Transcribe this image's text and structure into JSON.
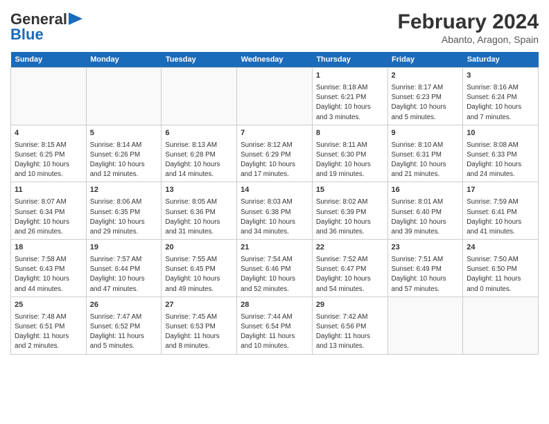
{
  "header": {
    "logo_line1": "General",
    "logo_line2": "Blue",
    "title": "February 2024",
    "subtitle": "Abanto, Aragon, Spain"
  },
  "weekdays": [
    "Sunday",
    "Monday",
    "Tuesday",
    "Wednesday",
    "Thursday",
    "Friday",
    "Saturday"
  ],
  "weeks": [
    [
      {
        "day": "",
        "info": ""
      },
      {
        "day": "",
        "info": ""
      },
      {
        "day": "",
        "info": ""
      },
      {
        "day": "",
        "info": ""
      },
      {
        "day": "1",
        "info": "Sunrise: 8:18 AM\nSunset: 6:21 PM\nDaylight: 10 hours\nand 3 minutes."
      },
      {
        "day": "2",
        "info": "Sunrise: 8:17 AM\nSunset: 6:23 PM\nDaylight: 10 hours\nand 5 minutes."
      },
      {
        "day": "3",
        "info": "Sunrise: 8:16 AM\nSunset: 6:24 PM\nDaylight: 10 hours\nand 7 minutes."
      }
    ],
    [
      {
        "day": "4",
        "info": "Sunrise: 8:15 AM\nSunset: 6:25 PM\nDaylight: 10 hours\nand 10 minutes."
      },
      {
        "day": "5",
        "info": "Sunrise: 8:14 AM\nSunset: 6:26 PM\nDaylight: 10 hours\nand 12 minutes."
      },
      {
        "day": "6",
        "info": "Sunrise: 8:13 AM\nSunset: 6:28 PM\nDaylight: 10 hours\nand 14 minutes."
      },
      {
        "day": "7",
        "info": "Sunrise: 8:12 AM\nSunset: 6:29 PM\nDaylight: 10 hours\nand 17 minutes."
      },
      {
        "day": "8",
        "info": "Sunrise: 8:11 AM\nSunset: 6:30 PM\nDaylight: 10 hours\nand 19 minutes."
      },
      {
        "day": "9",
        "info": "Sunrise: 8:10 AM\nSunset: 6:31 PM\nDaylight: 10 hours\nand 21 minutes."
      },
      {
        "day": "10",
        "info": "Sunrise: 8:08 AM\nSunset: 6:33 PM\nDaylight: 10 hours\nand 24 minutes."
      }
    ],
    [
      {
        "day": "11",
        "info": "Sunrise: 8:07 AM\nSunset: 6:34 PM\nDaylight: 10 hours\nand 26 minutes."
      },
      {
        "day": "12",
        "info": "Sunrise: 8:06 AM\nSunset: 6:35 PM\nDaylight: 10 hours\nand 29 minutes."
      },
      {
        "day": "13",
        "info": "Sunrise: 8:05 AM\nSunset: 6:36 PM\nDaylight: 10 hours\nand 31 minutes."
      },
      {
        "day": "14",
        "info": "Sunrise: 8:03 AM\nSunset: 6:38 PM\nDaylight: 10 hours\nand 34 minutes."
      },
      {
        "day": "15",
        "info": "Sunrise: 8:02 AM\nSunset: 6:39 PM\nDaylight: 10 hours\nand 36 minutes."
      },
      {
        "day": "16",
        "info": "Sunrise: 8:01 AM\nSunset: 6:40 PM\nDaylight: 10 hours\nand 39 minutes."
      },
      {
        "day": "17",
        "info": "Sunrise: 7:59 AM\nSunset: 6:41 PM\nDaylight: 10 hours\nand 41 minutes."
      }
    ],
    [
      {
        "day": "18",
        "info": "Sunrise: 7:58 AM\nSunset: 6:43 PM\nDaylight: 10 hours\nand 44 minutes."
      },
      {
        "day": "19",
        "info": "Sunrise: 7:57 AM\nSunset: 6:44 PM\nDaylight: 10 hours\nand 47 minutes."
      },
      {
        "day": "20",
        "info": "Sunrise: 7:55 AM\nSunset: 6:45 PM\nDaylight: 10 hours\nand 49 minutes."
      },
      {
        "day": "21",
        "info": "Sunrise: 7:54 AM\nSunset: 6:46 PM\nDaylight: 10 hours\nand 52 minutes."
      },
      {
        "day": "22",
        "info": "Sunrise: 7:52 AM\nSunset: 6:47 PM\nDaylight: 10 hours\nand 54 minutes."
      },
      {
        "day": "23",
        "info": "Sunrise: 7:51 AM\nSunset: 6:49 PM\nDaylight: 10 hours\nand 57 minutes."
      },
      {
        "day": "24",
        "info": "Sunrise: 7:50 AM\nSunset: 6:50 PM\nDaylight: 11 hours\nand 0 minutes."
      }
    ],
    [
      {
        "day": "25",
        "info": "Sunrise: 7:48 AM\nSunset: 6:51 PM\nDaylight: 11 hours\nand 2 minutes."
      },
      {
        "day": "26",
        "info": "Sunrise: 7:47 AM\nSunset: 6:52 PM\nDaylight: 11 hours\nand 5 minutes."
      },
      {
        "day": "27",
        "info": "Sunrise: 7:45 AM\nSunset: 6:53 PM\nDaylight: 11 hours\nand 8 minutes."
      },
      {
        "day": "28",
        "info": "Sunrise: 7:44 AM\nSunset: 6:54 PM\nDaylight: 11 hours\nand 10 minutes."
      },
      {
        "day": "29",
        "info": "Sunrise: 7:42 AM\nSunset: 6:56 PM\nDaylight: 11 hours\nand 13 minutes."
      },
      {
        "day": "",
        "info": ""
      },
      {
        "day": "",
        "info": ""
      }
    ]
  ]
}
